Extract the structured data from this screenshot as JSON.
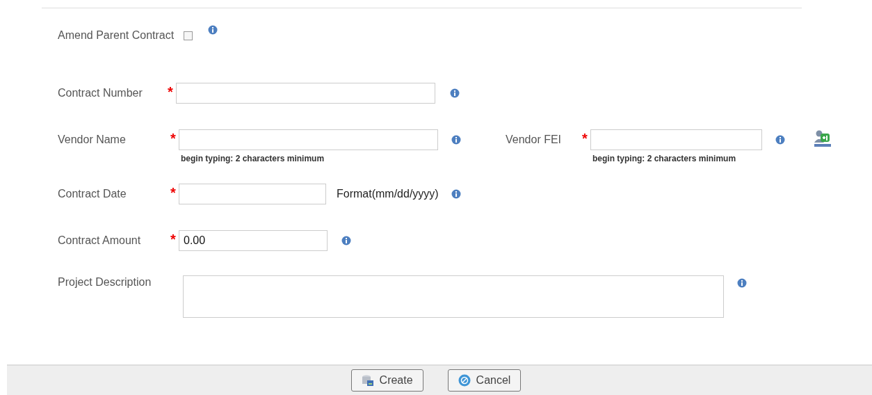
{
  "amend": {
    "label": "Amend Parent Contract",
    "checked": false
  },
  "contract_number": {
    "label": "Contract Number",
    "required_mark": "*"
  },
  "vendor_name": {
    "label": "Vendor Name",
    "required_mark": "*",
    "hint": "begin typing: 2 characters minimum"
  },
  "vendor_fei": {
    "label": "Vendor FEI",
    "required_mark": "*",
    "hint": "begin typing: 2 characters minimum"
  },
  "contract_date": {
    "label": "Contract Date",
    "required_mark": "*",
    "format": "Format(mm/dd/yyyy)"
  },
  "contract_amount": {
    "label": "Contract Amount",
    "required_mark": "*",
    "value": "0.00"
  },
  "project_description": {
    "label": "Project Description"
  },
  "buttons": [
    {
      "kind": "create",
      "label": "Create"
    },
    {
      "kind": "cancel",
      "label": "Cancel"
    }
  ]
}
